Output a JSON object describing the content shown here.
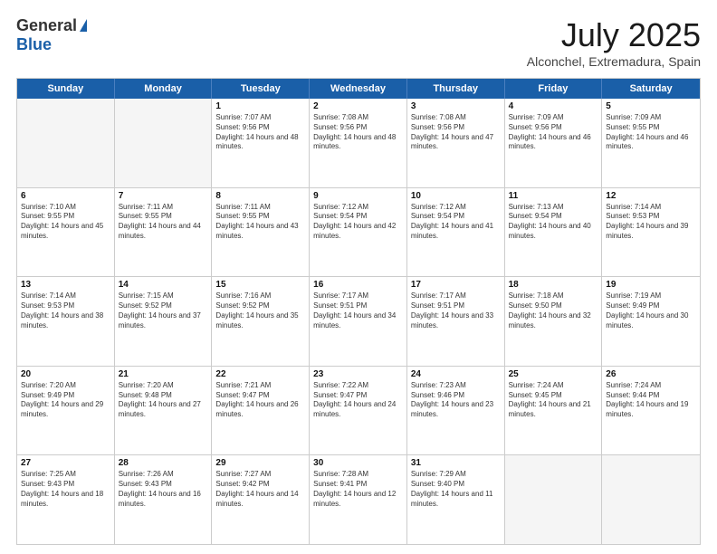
{
  "header": {
    "logo_general": "General",
    "logo_blue": "Blue",
    "month_title": "July 2025",
    "location": "Alconchel, Extremadura, Spain"
  },
  "calendar": {
    "days": [
      "Sunday",
      "Monday",
      "Tuesday",
      "Wednesday",
      "Thursday",
      "Friday",
      "Saturday"
    ],
    "rows": [
      [
        {
          "day": "",
          "empty": true
        },
        {
          "day": "",
          "empty": true
        },
        {
          "day": "1",
          "sunrise": "Sunrise: 7:07 AM",
          "sunset": "Sunset: 9:56 PM",
          "daylight": "Daylight: 14 hours and 48 minutes."
        },
        {
          "day": "2",
          "sunrise": "Sunrise: 7:08 AM",
          "sunset": "Sunset: 9:56 PM",
          "daylight": "Daylight: 14 hours and 48 minutes."
        },
        {
          "day": "3",
          "sunrise": "Sunrise: 7:08 AM",
          "sunset": "Sunset: 9:56 PM",
          "daylight": "Daylight: 14 hours and 47 minutes."
        },
        {
          "day": "4",
          "sunrise": "Sunrise: 7:09 AM",
          "sunset": "Sunset: 9:56 PM",
          "daylight": "Daylight: 14 hours and 46 minutes."
        },
        {
          "day": "5",
          "sunrise": "Sunrise: 7:09 AM",
          "sunset": "Sunset: 9:55 PM",
          "daylight": "Daylight: 14 hours and 46 minutes."
        }
      ],
      [
        {
          "day": "6",
          "sunrise": "Sunrise: 7:10 AM",
          "sunset": "Sunset: 9:55 PM",
          "daylight": "Daylight: 14 hours and 45 minutes."
        },
        {
          "day": "7",
          "sunrise": "Sunrise: 7:11 AM",
          "sunset": "Sunset: 9:55 PM",
          "daylight": "Daylight: 14 hours and 44 minutes."
        },
        {
          "day": "8",
          "sunrise": "Sunrise: 7:11 AM",
          "sunset": "Sunset: 9:55 PM",
          "daylight": "Daylight: 14 hours and 43 minutes."
        },
        {
          "day": "9",
          "sunrise": "Sunrise: 7:12 AM",
          "sunset": "Sunset: 9:54 PM",
          "daylight": "Daylight: 14 hours and 42 minutes."
        },
        {
          "day": "10",
          "sunrise": "Sunrise: 7:12 AM",
          "sunset": "Sunset: 9:54 PM",
          "daylight": "Daylight: 14 hours and 41 minutes."
        },
        {
          "day": "11",
          "sunrise": "Sunrise: 7:13 AM",
          "sunset": "Sunset: 9:54 PM",
          "daylight": "Daylight: 14 hours and 40 minutes."
        },
        {
          "day": "12",
          "sunrise": "Sunrise: 7:14 AM",
          "sunset": "Sunset: 9:53 PM",
          "daylight": "Daylight: 14 hours and 39 minutes."
        }
      ],
      [
        {
          "day": "13",
          "sunrise": "Sunrise: 7:14 AM",
          "sunset": "Sunset: 9:53 PM",
          "daylight": "Daylight: 14 hours and 38 minutes."
        },
        {
          "day": "14",
          "sunrise": "Sunrise: 7:15 AM",
          "sunset": "Sunset: 9:52 PM",
          "daylight": "Daylight: 14 hours and 37 minutes."
        },
        {
          "day": "15",
          "sunrise": "Sunrise: 7:16 AM",
          "sunset": "Sunset: 9:52 PM",
          "daylight": "Daylight: 14 hours and 35 minutes."
        },
        {
          "day": "16",
          "sunrise": "Sunrise: 7:17 AM",
          "sunset": "Sunset: 9:51 PM",
          "daylight": "Daylight: 14 hours and 34 minutes."
        },
        {
          "day": "17",
          "sunrise": "Sunrise: 7:17 AM",
          "sunset": "Sunset: 9:51 PM",
          "daylight": "Daylight: 14 hours and 33 minutes."
        },
        {
          "day": "18",
          "sunrise": "Sunrise: 7:18 AM",
          "sunset": "Sunset: 9:50 PM",
          "daylight": "Daylight: 14 hours and 32 minutes."
        },
        {
          "day": "19",
          "sunrise": "Sunrise: 7:19 AM",
          "sunset": "Sunset: 9:49 PM",
          "daylight": "Daylight: 14 hours and 30 minutes."
        }
      ],
      [
        {
          "day": "20",
          "sunrise": "Sunrise: 7:20 AM",
          "sunset": "Sunset: 9:49 PM",
          "daylight": "Daylight: 14 hours and 29 minutes."
        },
        {
          "day": "21",
          "sunrise": "Sunrise: 7:20 AM",
          "sunset": "Sunset: 9:48 PM",
          "daylight": "Daylight: 14 hours and 27 minutes."
        },
        {
          "day": "22",
          "sunrise": "Sunrise: 7:21 AM",
          "sunset": "Sunset: 9:47 PM",
          "daylight": "Daylight: 14 hours and 26 minutes."
        },
        {
          "day": "23",
          "sunrise": "Sunrise: 7:22 AM",
          "sunset": "Sunset: 9:47 PM",
          "daylight": "Daylight: 14 hours and 24 minutes."
        },
        {
          "day": "24",
          "sunrise": "Sunrise: 7:23 AM",
          "sunset": "Sunset: 9:46 PM",
          "daylight": "Daylight: 14 hours and 23 minutes."
        },
        {
          "day": "25",
          "sunrise": "Sunrise: 7:24 AM",
          "sunset": "Sunset: 9:45 PM",
          "daylight": "Daylight: 14 hours and 21 minutes."
        },
        {
          "day": "26",
          "sunrise": "Sunrise: 7:24 AM",
          "sunset": "Sunset: 9:44 PM",
          "daylight": "Daylight: 14 hours and 19 minutes."
        }
      ],
      [
        {
          "day": "27",
          "sunrise": "Sunrise: 7:25 AM",
          "sunset": "Sunset: 9:43 PM",
          "daylight": "Daylight: 14 hours and 18 minutes."
        },
        {
          "day": "28",
          "sunrise": "Sunrise: 7:26 AM",
          "sunset": "Sunset: 9:43 PM",
          "daylight": "Daylight: 14 hours and 16 minutes."
        },
        {
          "day": "29",
          "sunrise": "Sunrise: 7:27 AM",
          "sunset": "Sunset: 9:42 PM",
          "daylight": "Daylight: 14 hours and 14 minutes."
        },
        {
          "day": "30",
          "sunrise": "Sunrise: 7:28 AM",
          "sunset": "Sunset: 9:41 PM",
          "daylight": "Daylight: 14 hours and 12 minutes."
        },
        {
          "day": "31",
          "sunrise": "Sunrise: 7:29 AM",
          "sunset": "Sunset: 9:40 PM",
          "daylight": "Daylight: 14 hours and 11 minutes."
        },
        {
          "day": "",
          "empty": true
        },
        {
          "day": "",
          "empty": true
        }
      ]
    ]
  }
}
